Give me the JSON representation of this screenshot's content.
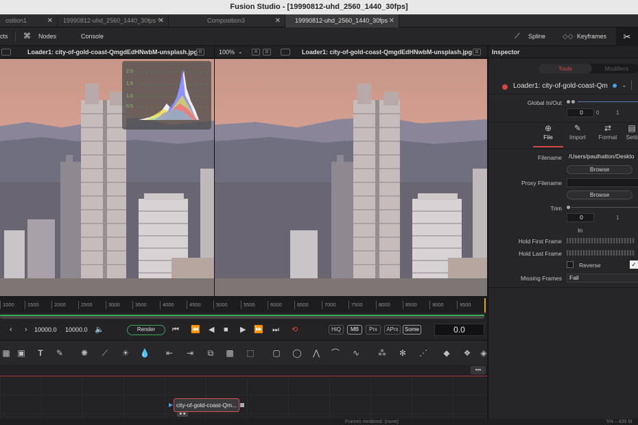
{
  "window": {
    "title": "Fusion Studio - [19990812-uhd_2560_1440_30fps]"
  },
  "tabs": [
    {
      "label": "osition1"
    },
    {
      "label": "19990812-uhd_2560_1440_30fps *"
    },
    {
      "label": "Composition3"
    },
    {
      "label": "19990812-uhd_2560_1440_30fps"
    }
  ],
  "toolbar": {
    "effects": "cts",
    "nodes": "Nodes",
    "console": "Console",
    "spline": "Spline",
    "keyframes": "Keyframes"
  },
  "viewer_left": {
    "name": "Loader1: city-of-gold-coast-QmgdEdHNwbM-unsplash.jpg",
    "zoom": "100%"
  },
  "viewer_right": {
    "name": "Loader1: city-of-gold-coast-QmgdEdHNwbM-unsplash.jpg"
  },
  "histogram": {
    "labels": [
      "2.0",
      "1.5",
      "1.0",
      "0.5"
    ]
  },
  "ruler": {
    "ticks": [
      "1000",
      "1500",
      "2000",
      "2500",
      "3000",
      "3500",
      "4000",
      "4500",
      "5000",
      "5500",
      "6000",
      "6500",
      "7000",
      "7500",
      "8000",
      "8500",
      "9000",
      "9500"
    ]
  },
  "transport": {
    "range_start": "10000.0",
    "range_end": "10000.0",
    "render": "Render",
    "hiq": "HiQ",
    "mb": "MB",
    "prx": "Prx",
    "aprx": "APrx",
    "some": "Some",
    "current_time": "0.0"
  },
  "node_editor": {
    "node_label": "city-of-gold-coast-Qm...",
    "more": "•••"
  },
  "status": {
    "frames_rendered": "Frames rendered: (none)",
    "memory": "5% – 839 M"
  },
  "inspector": {
    "title": "Inspector",
    "tab_tools": "Tools",
    "tab_modifiers": "Modifiers",
    "tool_name": "Loader1: city-of-gold-coast-Qm",
    "global_inout_label": "Global In/Out",
    "global_in": "0",
    "global_ticks": [
      "0",
      "1"
    ],
    "subtabs": [
      "File",
      "Import",
      "Format",
      "Setti"
    ],
    "filename_label": "Filename",
    "filename_value": "/Users/paulhatton/Deskto",
    "browse": "Browse",
    "proxy_label": "Proxy Filename",
    "trim_label": "Trim",
    "trim_in": "0",
    "trim_tick": "1",
    "trim_in_caption": "In",
    "hold_first_label": "Hold First Frame",
    "hold_last_label": "Hold Last Frame",
    "reverse_label": "Reverse",
    "missing_label": "Missing Frames",
    "missing_value": "Fail"
  },
  "colors": {
    "accent_red": "#d64545",
    "ruler_marker": "#e8a020",
    "render_green": "#3aa55a"
  }
}
